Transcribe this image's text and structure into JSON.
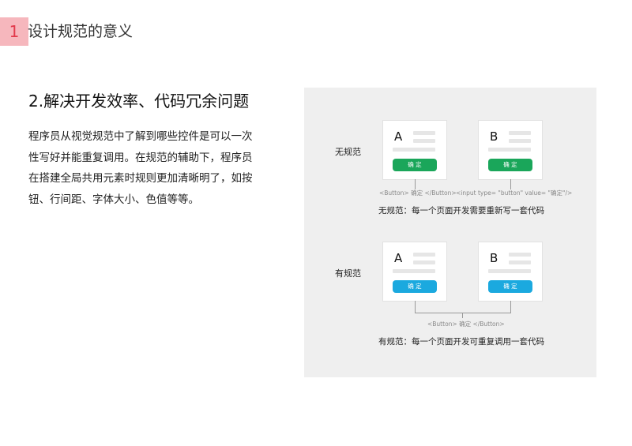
{
  "section": {
    "number": "1",
    "title": "设计规范的意义"
  },
  "heading": "2.解决开发效率、代码冗余问题",
  "paragraph": "程序员从视觉规范中了解到哪些控件是可以一次性写好并能重复调用。在规范的辅助下，程序员在搭建全局共用元素时规则更加清晰明了，如按钮、行间距、字体大小、色值等等。",
  "diagram": {
    "without_spec": {
      "label": "无规范",
      "card_a_letter": "A",
      "card_b_letter": "B",
      "button_label_a": "确 定",
      "button_label_b": "确 定",
      "code_a": "<Button> 确定 </Button>",
      "code_b": "<input type= \"button\" value= \"确定\"/>",
      "caption": "无规范：每一个页面开发需要重新写一套代码",
      "button_color": "#1aa65a"
    },
    "with_spec": {
      "label": "有规范",
      "card_a_letter": "A",
      "card_b_letter": "B",
      "button_label_a": "确 定",
      "button_label_b": "确 定",
      "code": "<Button> 确定 </Button>",
      "caption": "有规范：每一个页面开发可重复调用一套代码",
      "button_color": "#1ba9df"
    }
  },
  "colors": {
    "section_badge_bg": "#f6b7bd",
    "section_badge_text": "#e23a4c",
    "panel_bg": "#efefef"
  }
}
